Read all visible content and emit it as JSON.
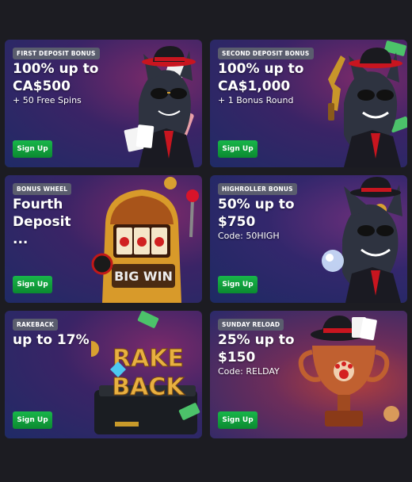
{
  "promotions": [
    {
      "badge": "FIRST DEPOSIT BONUS",
      "headline": "100% up to CA$500",
      "subtext": "+ 50 Free Spins",
      "button": "Sign Up",
      "art": "cat-mascot-cards-icon"
    },
    {
      "badge": "SECOND DEPOSIT BONUS",
      "headline": "100% up to CA$1,000",
      "subtext": "+ 1 Bonus Round",
      "button": "Sign Up",
      "art": "cat-mascot-gun-icon"
    },
    {
      "badge": "BONUS WHEEL",
      "headline": "Fourth Deposit ...",
      "subtext": "",
      "button": "Sign Up",
      "art": "slot-machine-icon"
    },
    {
      "badge": "HIGHROLLER BONUS",
      "headline": "50% up to $750",
      "subtext": "Code: 50HIGH",
      "button": "Sign Up",
      "art": "cat-mascot-orb-icon"
    },
    {
      "badge": "RAKEBACK",
      "headline": "up to 17%",
      "subtext": "",
      "button": "Sign Up",
      "art": "rakeback-briefcase-icon"
    },
    {
      "badge": "SUNDAY RELOAD",
      "headline": "25% up to $150",
      "subtext": "Code: RELDAY",
      "button": "Sign Up",
      "art": "trophy-icon"
    }
  ],
  "art_text": {
    "slot": "BIG WIN",
    "rake": "RAKE",
    "back": "BACK"
  },
  "colors": {
    "page_bg": "#1c1c22",
    "button_green": "#12a03e",
    "badge_bg": "#5a5d6e"
  }
}
